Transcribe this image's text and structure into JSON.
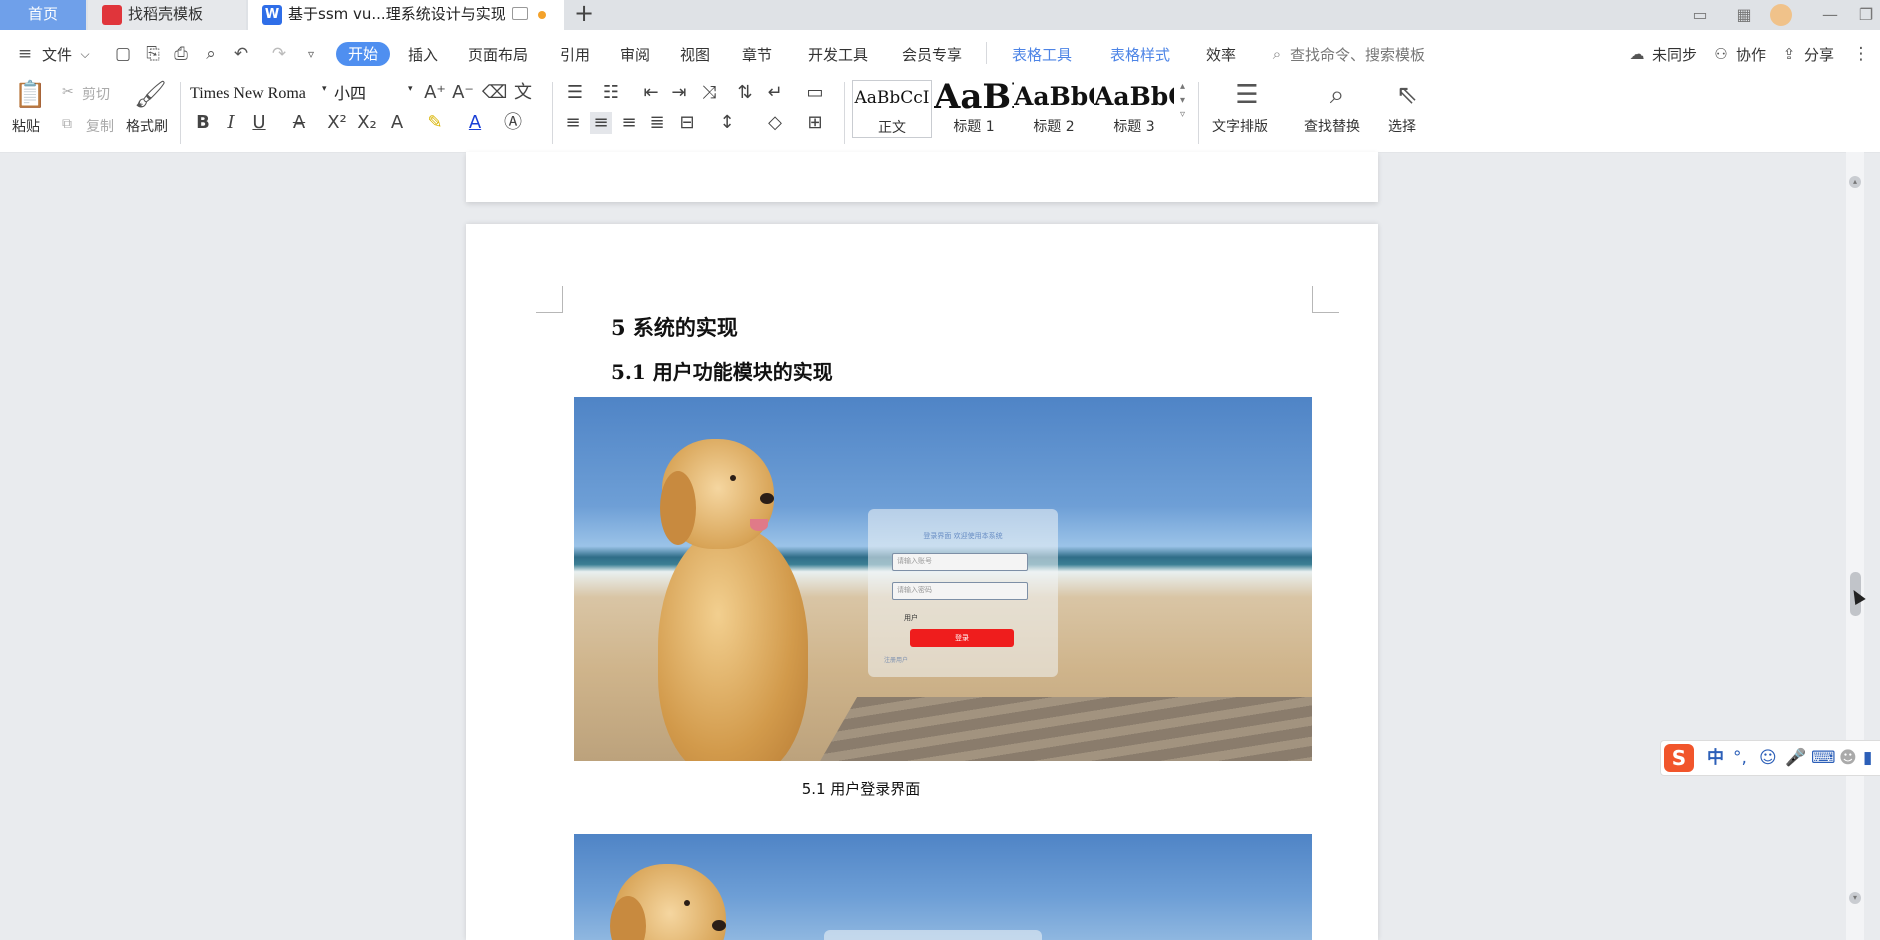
{
  "tabs": {
    "home": "首页",
    "daoke": "找稻壳模板",
    "doc": "基于ssm vu...理系统设计与实现"
  },
  "menu": {
    "file": "文件",
    "items": [
      "开始",
      "插入",
      "页面布局",
      "引用",
      "审阅",
      "视图",
      "章节",
      "开发工具",
      "会员专享"
    ],
    "table_tools": "表格工具",
    "table_style": "表格样式",
    "efficiency": "效率",
    "search_placeholder": "查找命令、搜索模板",
    "unsynced": "未同步",
    "collab": "协作",
    "share": "分享"
  },
  "ribbon": {
    "paste": "粘贴",
    "cut": "剪切",
    "copy": "复制",
    "format_painter": "格式刷",
    "font_name": "Times New Roma",
    "font_size": "小四",
    "styles": [
      {
        "sample": "AaBbCcI",
        "label": "正文"
      },
      {
        "sample": "AaBl",
        "label": "标题 1"
      },
      {
        "sample": "AaBbC",
        "label": "标题 2"
      },
      {
        "sample": "AaBbC",
        "label": "标题 3"
      }
    ],
    "text_layout": "文字排版",
    "find_replace": "查找替换",
    "select": "选择"
  },
  "document": {
    "heading1": "5   系统的实现",
    "heading2": "5.1  用户功能模块的实现",
    "caption": "5.1  用户登录界面",
    "login": {
      "tip": "登录界面 欢迎使用本系统",
      "account_placeholder": "请输入账号",
      "password_placeholder": "请输入密码",
      "role": "用户",
      "login_button": "登录",
      "register": "注册用户"
    }
  },
  "ime": {
    "logo": "S",
    "lang": "中"
  }
}
